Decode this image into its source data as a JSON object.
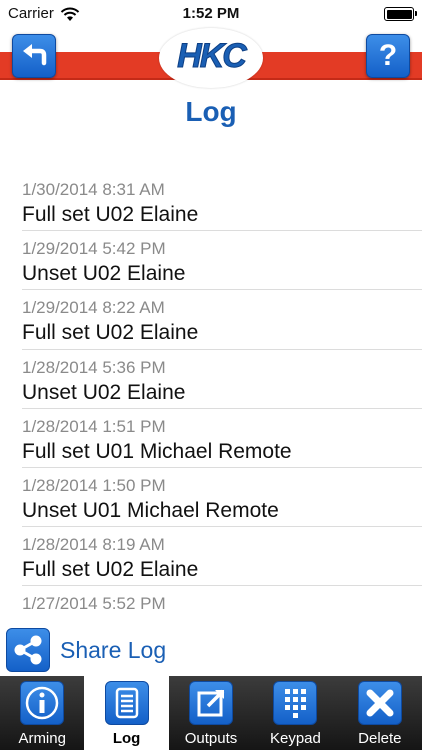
{
  "status_bar": {
    "carrier": "Carrier",
    "time": "1:52 PM"
  },
  "header": {
    "logo_text": "HKC",
    "help_label": "?",
    "title": "Log"
  },
  "log": {
    "items": [
      {
        "time": "1/30/2014 8:31 AM",
        "event": "Full set U02 Elaine"
      },
      {
        "time": "1/29/2014 5:42 PM",
        "event": "Unset U02 Elaine"
      },
      {
        "time": "1/29/2014 8:22 AM",
        "event": "Full set U02 Elaine"
      },
      {
        "time": "1/28/2014 5:36 PM",
        "event": "Unset U02 Elaine"
      },
      {
        "time": "1/28/2014 1:51 PM",
        "event": "Full set U01 Michael Remote"
      },
      {
        "time": "1/28/2014 1:50 PM",
        "event": "Unset U01 Michael Remote"
      },
      {
        "time": "1/28/2014 8:19 AM",
        "event": "Full set U02 Elaine"
      },
      {
        "time": "1/27/2014 5:52 PM",
        "event": ""
      }
    ]
  },
  "share": {
    "label": "Share Log",
    "icon": "share-icon"
  },
  "tabs": [
    {
      "label": "Arming",
      "icon": "info-icon"
    },
    {
      "label": "Log",
      "icon": "document-icon",
      "active": true
    },
    {
      "label": "Outputs",
      "icon": "external-link-icon"
    },
    {
      "label": "Keypad",
      "icon": "keypad-icon"
    },
    {
      "label": "Delete",
      "icon": "close-icon"
    }
  ],
  "colors": {
    "accent_blue": "#1a5fb4",
    "header_red": "#e33b25",
    "tab_bar": "#1f1f1f"
  }
}
